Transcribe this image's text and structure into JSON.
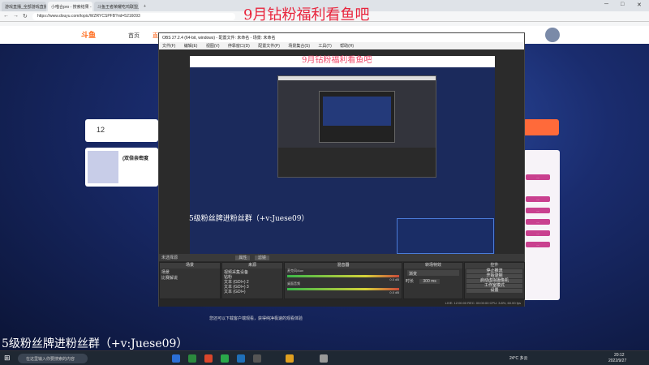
{
  "browser": {
    "tabs": [
      "游戏直播_全部游戏直播_斗鱼直",
      "小喵合pro - 搜索结果 - 斗鱼直",
      "斗鱼王者荣耀吃鸡联盟_斗鱼直",
      "+"
    ],
    "url": "https://www.douyu.com/topic/WZRYCSPFB?rid=5216093"
  },
  "site": {
    "logo": "斗鱼",
    "nav": [
      "首页",
      "直播"
    ],
    "follow_count": "12",
    "room_title": "(双倍亲密度",
    "chat_buttons": [
      "...",
      "...",
      "...",
      "...",
      "...",
      "..."
    ],
    "below_text": "您还可以下载客户端观看，获得纯净极速的观看体验"
  },
  "obs": {
    "title": "OBS 27.2.4 (64-bit, windows) - 配置文件: 未命名 - 场景: 未命名",
    "menu": [
      "文件(F)",
      "编辑(E)",
      "视图(V)",
      "停靠窗口(D)",
      "配置文件(P)",
      "场景集合(S)",
      "工具(T)",
      "帮助(H)"
    ],
    "source_bar": "未选择源",
    "source_bar_buttons": [
      "属性",
      "滤镜"
    ],
    "docks": {
      "scenes": {
        "title": "场景",
        "items": [
          "场景",
          "比赛解说"
        ]
      },
      "sources": {
        "title": "来源",
        "items": [
          "视频采集设备",
          "钻粉",
          "文本 (GDI+) 2",
          "文本 (GDI+) 3",
          "文本 (GDI+)",
          "显示器采集"
        ]
      },
      "mixer": {
        "title": "混音器",
        "channels": [
          {
            "name": "麦克风/Aux",
            "db": "0.0 dB"
          },
          {
            "name": "桌面音频",
            "db": "0.0 dB"
          }
        ]
      },
      "transitions": {
        "title": "转场特效",
        "type": "渐变",
        "duration_label": "时长",
        "duration": "300 ms"
      },
      "controls": {
        "title": "控件",
        "buttons": [
          "停止推流",
          "开始录制",
          "启动虚拟摄像机",
          "工作室模式",
          "设置",
          "退出"
        ]
      }
    },
    "status": "LIVE: 12:00:00  REC: 00:00:00  CPU: 3.8%, 60.00 fps"
  },
  "overlays": {
    "top": "9月钻粉福利看鱼吧",
    "preview": "9月钻粉福利看鱼吧",
    "obs_bottom": "5级粉丝牌进粉丝群（+v:Juese09）",
    "bottom_left": "5级粉丝牌进粉丝群（+v:Juese09）"
  },
  "taskbar": {
    "search": "在这里输入你要搜索的内容",
    "weather": "24°C 多云",
    "time": "20:12",
    "date": "2022/9/27",
    "icon_colors": [
      "#2b6fd6",
      "#2b8a3e",
      "#d9462b",
      "#2aa84a",
      "#1f6fb8",
      "#555555",
      "#e0a020",
      "#999999"
    ]
  }
}
